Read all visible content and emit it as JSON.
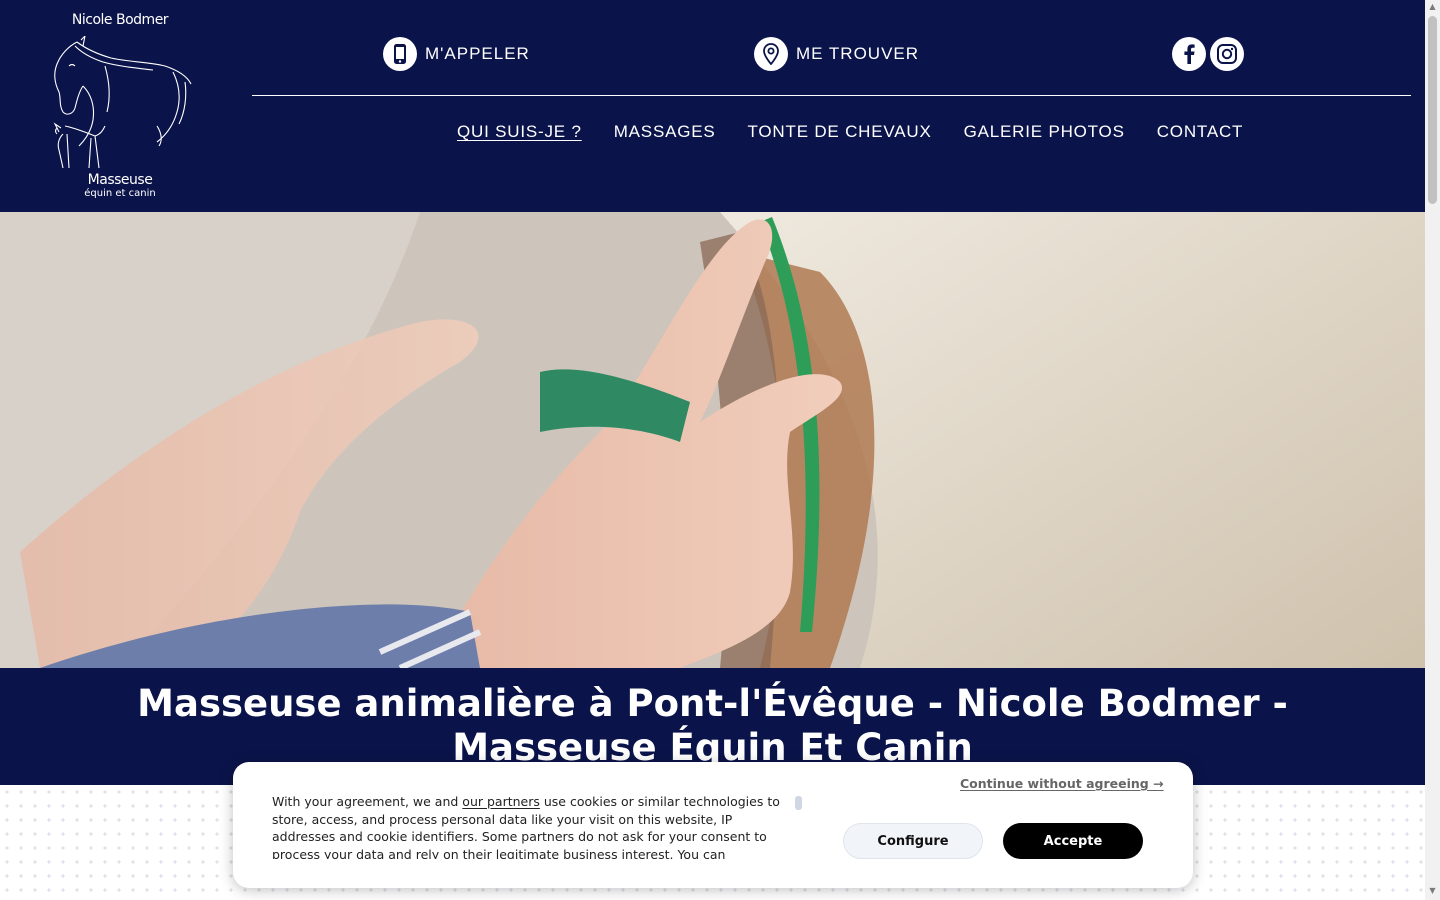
{
  "colors": {
    "brand_navy": "#0b144a",
    "accept_button": "#000000",
    "configure_button": "#f1f4f9"
  },
  "logo": {
    "name": "Nicole Bodmer",
    "title": "Masseuse",
    "subtitle": "équin et canin"
  },
  "topbar": {
    "call": {
      "icon": "phone-icon",
      "label": "M'APPELER"
    },
    "find": {
      "icon": "location-pin-icon",
      "label": "ME TROUVER"
    },
    "social": [
      {
        "icon": "facebook-icon"
      },
      {
        "icon": "instagram-icon"
      }
    ]
  },
  "nav": {
    "items": [
      {
        "label": "QUI SUIS-JE ?",
        "active": true
      },
      {
        "label": "MASSAGES"
      },
      {
        "label": "TONTE DE CHEVAUX"
      },
      {
        "label": "GALERIE PHOTOS"
      },
      {
        "label": "CONTACT"
      }
    ]
  },
  "hero": {
    "image": "hands-massaging-horse-with-green-brush"
  },
  "main": {
    "title": "Masseuse animalière à Pont-l'Évêque - Nicole Bodmer - Masseuse Équin Et Canin"
  },
  "cookie": {
    "text_before_link": "With your agreement, we and ",
    "link": "our partners",
    "text_after_link": " use cookies or similar technologies to store, access, and process personal data like your visit on this website, IP addresses and cookie identifiers. Some partners do not ask for your consent to process your data and rely on their legitimate business interest. You can",
    "continue_label": "Continue without agreeing →",
    "configure_label": "Configure",
    "accept_label": "Accepte"
  }
}
